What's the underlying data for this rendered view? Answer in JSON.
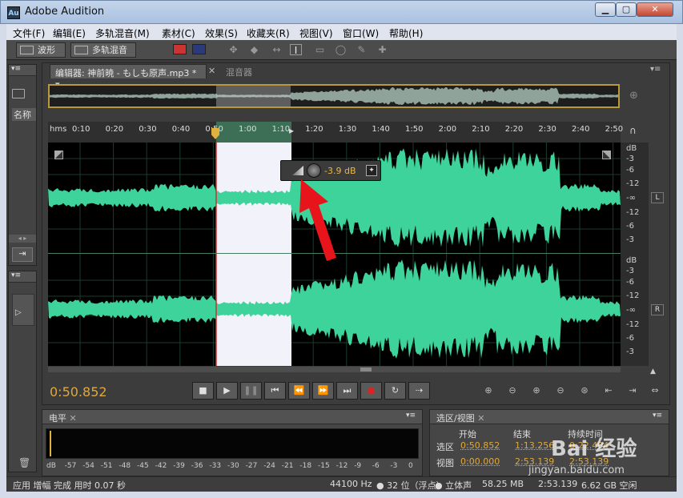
{
  "window": {
    "app_icon_text": "Au",
    "title": "Adobe Audition"
  },
  "menubar": {
    "items": [
      "文件(F)",
      "编辑(E)",
      "多轨混音(M)",
      "素材(C)",
      "效果(S)",
      "收藏夹(R)",
      "视图(V)",
      "窗口(W)",
      "帮助(H)"
    ]
  },
  "toolbar": {
    "waveform_label": "波形",
    "multitrack_label": "多轨混音"
  },
  "files_panel": {
    "column_header": "名称"
  },
  "editor": {
    "tab_label": "编辑器: 神前暁 - もしも原声.mp3 *",
    "mixer_tab_label": "混音器",
    "ruler": {
      "unit": "hms",
      "ticks": [
        "0:10",
        "0:20",
        "0:30",
        "0:40",
        "0:50",
        "1:00",
        "1:10",
        "1:20",
        "1:30",
        "1:40",
        "1:50",
        "2:00",
        "2:10",
        "2:20",
        "2:30",
        "2:40",
        "2:50"
      ]
    },
    "db_scale": {
      "top": [
        "dB",
        "-3",
        "-6",
        "-12",
        "-∞",
        "-12",
        "-6",
        "-3"
      ],
      "bottom": [
        "dB",
        "-3",
        "-6",
        "-12",
        "-∞",
        "-12",
        "-6",
        "-3"
      ]
    },
    "channels": {
      "left": "L",
      "right": "R"
    },
    "hud": {
      "value": "-3.9 dB"
    },
    "waveform_color": "#3fd39c",
    "selection_color": "#f2f2fa"
  },
  "transport": {
    "timecode": "0:50.852",
    "stop_icon": "■",
    "play_icon": "▶",
    "pause_icon": "❚❚",
    "to_start_icon": "⏮",
    "rewind_icon": "⏪",
    "ffwd_icon": "⏩",
    "to_end_icon": "⏭",
    "record_icon": "●",
    "loop_icon": "↻",
    "skip_icon": "⇢"
  },
  "level_panel": {
    "title": "电平",
    "db_ticks": [
      "dB",
      "-57",
      "-54",
      "-51",
      "-48",
      "-45",
      "-42",
      "-39",
      "-36",
      "-33",
      "-30",
      "-27",
      "-24",
      "-21",
      "-18",
      "-15",
      "-12",
      "-9",
      "-6",
      "-3",
      "0"
    ]
  },
  "selection_panel": {
    "title": "选区/视图",
    "headers": {
      "start": "开始",
      "end": "结束",
      "duration": "持续时间"
    },
    "rows": [
      {
        "label": "选区",
        "start": "0:50.852",
        "end": "1:13.256",
        "duration": "0:22.404"
      },
      {
        "label": "视图",
        "start": "0:00.000",
        "end": "2:53.139",
        "duration": "2:53.139"
      }
    ]
  },
  "statusbar": {
    "left": "应用 增幅 完成 用时 0.07 秒",
    "sample_rate": "44100 Hz",
    "bit_depth": "● 32 位（浮点）",
    "channels": "● 立体声",
    "file_size": "58.25 MB",
    "duration": "2:53.139",
    "free_space": "6.62 GB 空闲"
  },
  "watermark": {
    "brand": "Bai 经验",
    "url": "jingyan.baidu.com"
  }
}
